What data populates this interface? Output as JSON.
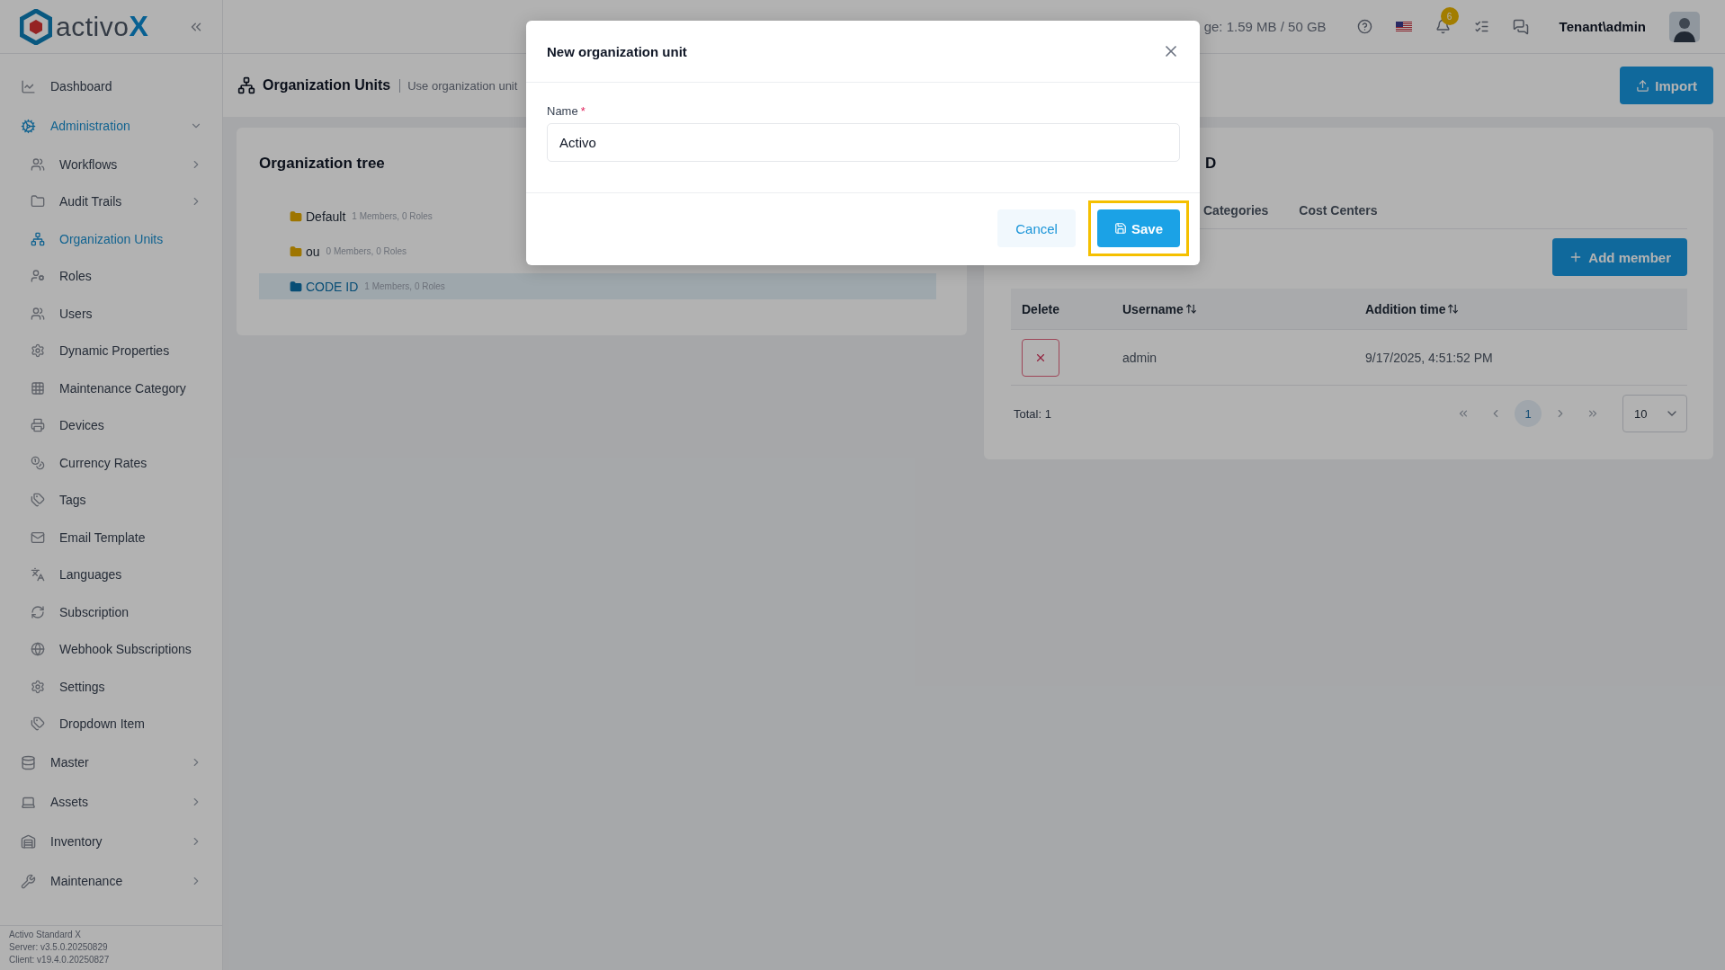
{
  "brand": {
    "name": "activo",
    "mark": "X"
  },
  "sidebar": {
    "items": [
      {
        "label": "Dashboard",
        "selected": false
      },
      {
        "label": "Administration",
        "selected": true,
        "expanded": true,
        "children": [
          {
            "label": "Workflows",
            "selected": false,
            "expanded": false
          },
          {
            "label": "Audit Trails",
            "selected": false,
            "expanded": false
          },
          {
            "label": "Organization Units",
            "selected": true
          },
          {
            "label": "Roles",
            "selected": false
          },
          {
            "label": "Users",
            "selected": false
          },
          {
            "label": "Dynamic Properties",
            "selected": false
          },
          {
            "label": "Maintenance Category",
            "selected": false
          },
          {
            "label": "Devices",
            "selected": false
          },
          {
            "label": "Currency Rates",
            "selected": false
          },
          {
            "label": "Tags",
            "selected": false
          },
          {
            "label": "Email Template",
            "selected": false
          },
          {
            "label": "Languages",
            "selected": false
          },
          {
            "label": "Subscription",
            "selected": false
          },
          {
            "label": "Webhook Subscriptions",
            "selected": false
          },
          {
            "label": "Settings",
            "selected": false
          },
          {
            "label": "Dropdown Item",
            "selected": false
          }
        ]
      },
      {
        "label": "Master",
        "selected": false,
        "expanded": false
      },
      {
        "label": "Assets",
        "selected": false,
        "expanded": false
      },
      {
        "label": "Inventory",
        "selected": false,
        "expanded": false
      },
      {
        "label": "Maintenance",
        "selected": false,
        "expanded": false
      }
    ],
    "footer": [
      "Activo Standard X",
      "Server: v3.5.0.20250829",
      "Client: v19.4.0.20250827"
    ]
  },
  "header": {
    "storage": "ge: 1.59 MB / 50 GB",
    "notifications": "6",
    "user": "Tenant\\admin"
  },
  "page": {
    "title": "Organization Units",
    "subtitle": "Use organization unit",
    "import_button": "Import"
  },
  "tree": {
    "title": "Organization tree",
    "nodes": [
      {
        "name": "Default",
        "info": "1 Members, 0 Roles",
        "selected": false
      },
      {
        "name": "ou",
        "info": "0 Members, 0 Roles",
        "selected": false
      },
      {
        "name": "CODE ID",
        "info": "1 Members, 0 Roles",
        "selected": true
      }
    ]
  },
  "detail": {
    "title": "D",
    "tabs": [
      {
        "label": "Categories",
        "selected": false
      },
      {
        "label": "Cost Centers",
        "selected": false
      }
    ],
    "add_button": "Add member",
    "columns": [
      "Delete",
      "Username",
      "Addition time"
    ],
    "rows": [
      {
        "username": "admin",
        "time": "9/17/2025, 4:51:52 PM"
      }
    ],
    "total": "Total: 1",
    "pages": [
      {
        "label": "1",
        "selected": true
      }
    ],
    "page_size": "10"
  },
  "dialog": {
    "title": "New organization unit",
    "field": {
      "label": "Name",
      "required_mark": "*",
      "value": "Activo"
    },
    "buttons": [
      {
        "label": "Cancel",
        "kind": "secondary",
        "highlighted": false
      },
      {
        "label": "Save",
        "kind": "primary",
        "highlighted": true
      }
    ]
  }
}
